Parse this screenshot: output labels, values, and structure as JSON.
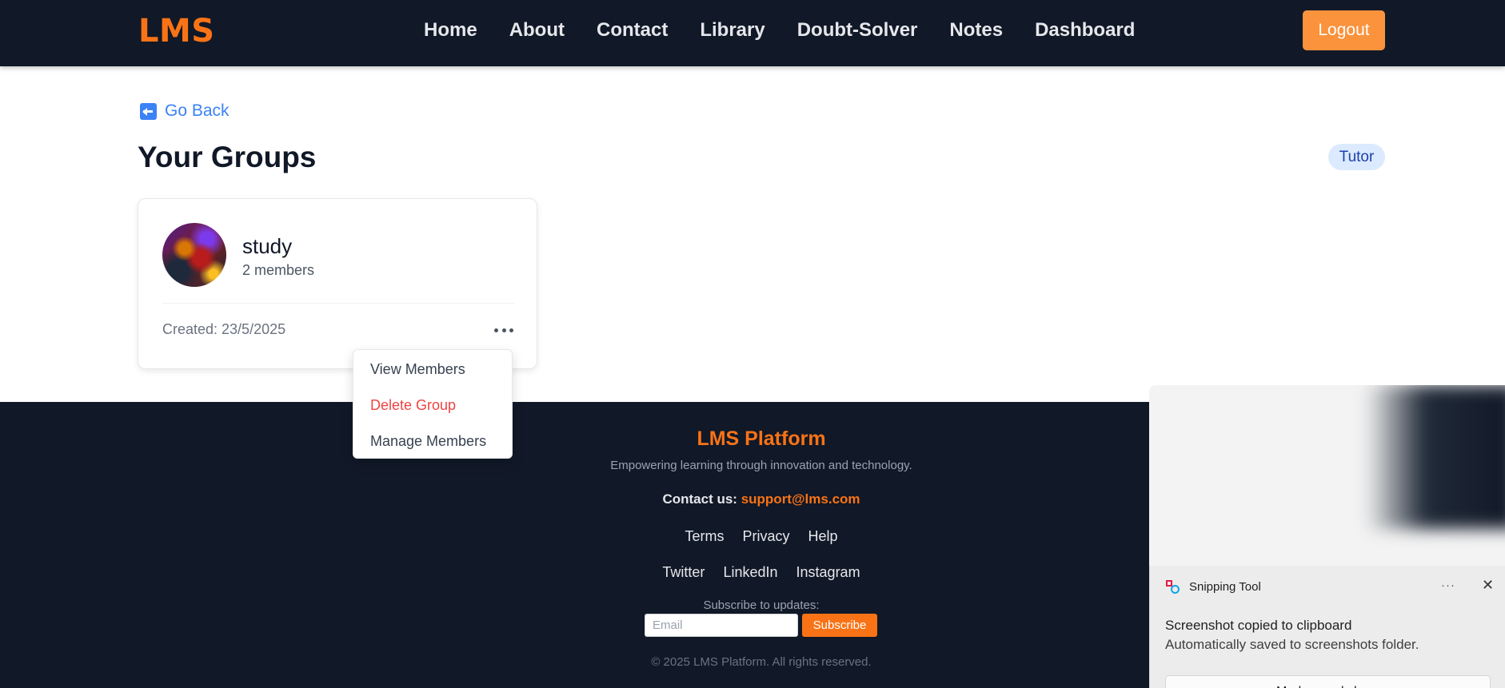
{
  "navbar": {
    "logo": "LMS",
    "links": [
      "Home",
      "About",
      "Contact",
      "Library",
      "Doubt-Solver",
      "Notes",
      "Dashboard"
    ],
    "logout_label": "Logout"
  },
  "main": {
    "go_back_label": "Go Back",
    "title": "Your Groups",
    "role_badge": "Tutor",
    "groups": [
      {
        "name": "study",
        "members": "2 members",
        "created": "Created: 23/5/2025"
      }
    ],
    "menu": {
      "view_members": "View Members",
      "delete_group": "Delete Group",
      "manage_members": "Manage Members"
    }
  },
  "footer": {
    "brand": "LMS Platform",
    "tagline": "Empowering learning through innovation and technology.",
    "contact_label": "Contact us:",
    "contact_email": "support@lms.com",
    "links": [
      "Terms",
      "Privacy",
      "Help"
    ],
    "social": [
      "Twitter",
      "LinkedIn",
      "Instagram"
    ],
    "subscribe_label": "Subscribe to updates:",
    "email_placeholder": "Email",
    "subscribe_button": "Subscribe",
    "copyright": "© 2025 LMS Platform. All rights reserved."
  },
  "notification": {
    "app_name": "Snipping Tool",
    "more": "···",
    "close": "✕",
    "title": "Screenshot copied to clipboard",
    "body": "Automatically saved to screenshots folder.",
    "action": "Markup and share"
  },
  "colors": {
    "accent": "#f97316",
    "navbar_bg": "#111827",
    "link_blue": "#3b82f6",
    "danger": "#ef4444"
  }
}
